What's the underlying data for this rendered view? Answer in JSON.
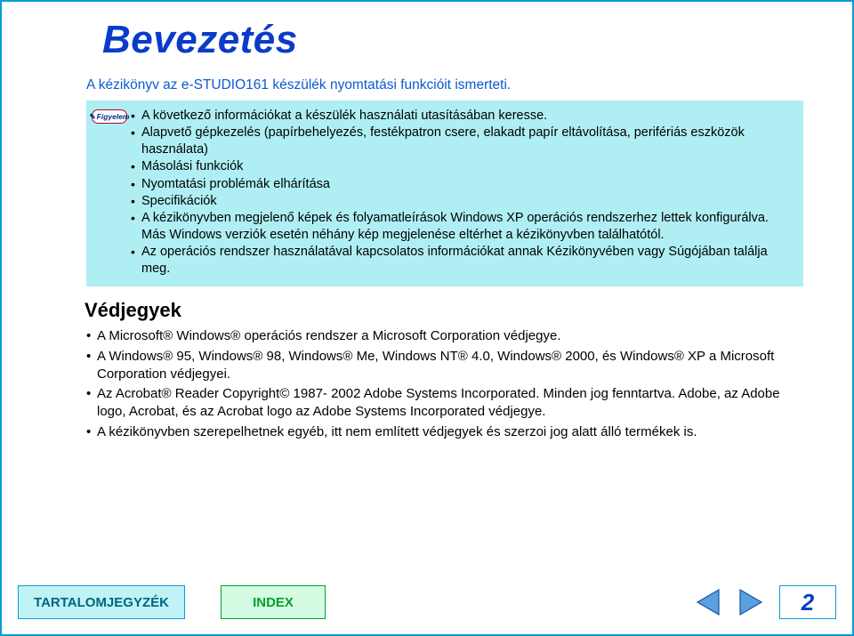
{
  "title": "Bevezetés",
  "intro": "A kézikönyv az e-STUDIO161 készülék nyomtatási funkcióit ismerteti.",
  "note": {
    "iconLabel": "Figyelem",
    "items": [
      "A következő információkat a készülék használati utasításában keresse.",
      "Alapvető gépkezelés (papírbehelyezés, festékpatron csere, elakadt papír eltávolítása, perifériás eszközök használata)",
      "Másolási funkciók",
      "Nyomtatási problémák elhárítása",
      "Specifikációk",
      "A kézikönyvben megjelenő képek és folyamatleírások Windows XP operációs rendszerhez lettek konfigurálva. Más Windows verziók esetén néhány kép megjelenése eltérhet a kézikönyvben találhatótól.",
      "Az operációs rendszer használatával kapcsolatos információkat annak Kézikönyvében vagy Súgójában találja meg."
    ]
  },
  "trademarks": {
    "heading": "Védjegyek",
    "items": [
      "A Microsoft® Windows® operációs rendszer a Microsoft Corporation védjegye.",
      "A Windows® 95, Windows® 98, Windows® Me, Windows NT® 4.0, Windows® 2000, és Windows® XP a Microsoft Corporation védjegyei.",
      "Az Acrobat® Reader Copyright© 1987- 2002 Adobe Systems Incorporated. Minden jog fenntartva. Adobe, az Adobe logo, Acrobat, és az Acrobat logo az Adobe Systems Incorporated védjegye.",
      "A kézikönyvben szerepelhetnek egyéb, itt nem említett védjegyek és szerzoi jog alatt álló termékek is."
    ]
  },
  "footer": {
    "toc": "TARTALOMJEGYZÉK",
    "index": "INDEX",
    "page": "2"
  }
}
